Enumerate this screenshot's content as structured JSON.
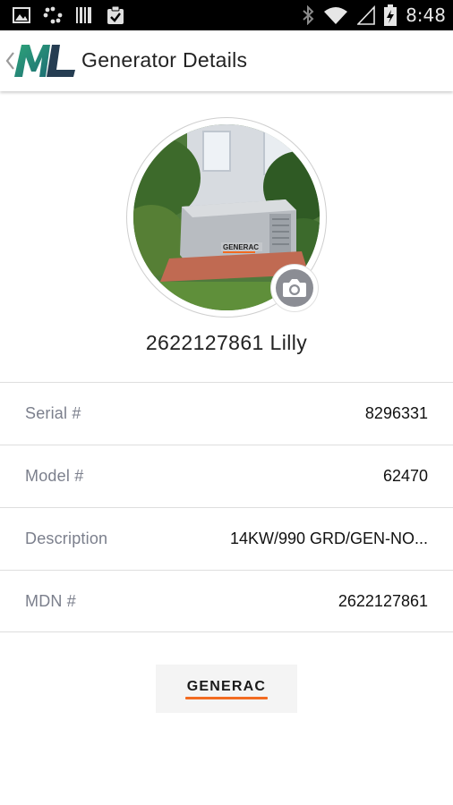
{
  "status_bar": {
    "time": "8:48",
    "icons": [
      "image-icon",
      "dots-icon",
      "barcode-icon",
      "clipboard-check-icon",
      "bluetooth-icon",
      "wifi-icon",
      "signal-icon",
      "battery-icon"
    ]
  },
  "app_bar": {
    "logo_text": "ML",
    "title": "Generator Details"
  },
  "generator": {
    "name": "2622127861 Lilly",
    "photo_brand": "GENERAC"
  },
  "details": [
    {
      "label": "Serial #",
      "value": "8296331"
    },
    {
      "label": "Model #",
      "value": "62470"
    },
    {
      "label": "Description",
      "value": "14KW/990 GRD/GEN-NO..."
    },
    {
      "label": "MDN #",
      "value": "2622127861"
    }
  ],
  "footer": {
    "brand": "GENERAC"
  },
  "colors": {
    "accent_green": "#2ea37a",
    "brand_orange": "#f26b21",
    "label_gray": "#7b7f8c"
  }
}
